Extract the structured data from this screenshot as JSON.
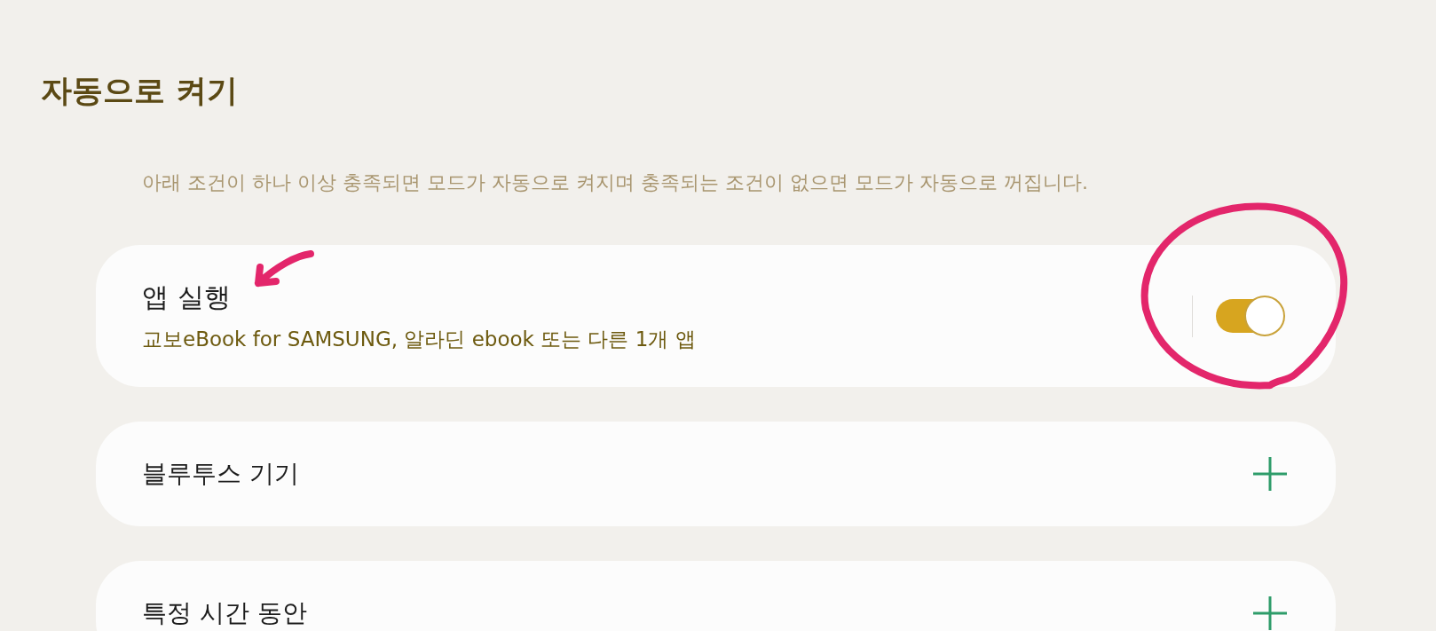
{
  "header": {
    "title": "자동으로 켜기",
    "description": "아래 조건이 하나 이상 충족되면 모드가 자동으로 켜지며 충족되는 조건이 없으면 모드가 자동으로 꺼집니다."
  },
  "conditions": [
    {
      "kind": "toggle",
      "title": "앱 실행",
      "subtitle": "교보eBook for SAMSUNG, 알라딘 ebook 또는 다른 1개 앱",
      "on": true
    },
    {
      "kind": "add",
      "title": "블루투스 기기"
    },
    {
      "kind": "add",
      "title": "특정 시간 동안"
    }
  ],
  "annotations": [
    {
      "kind": "circle"
    },
    {
      "kind": "arrow"
    }
  ]
}
